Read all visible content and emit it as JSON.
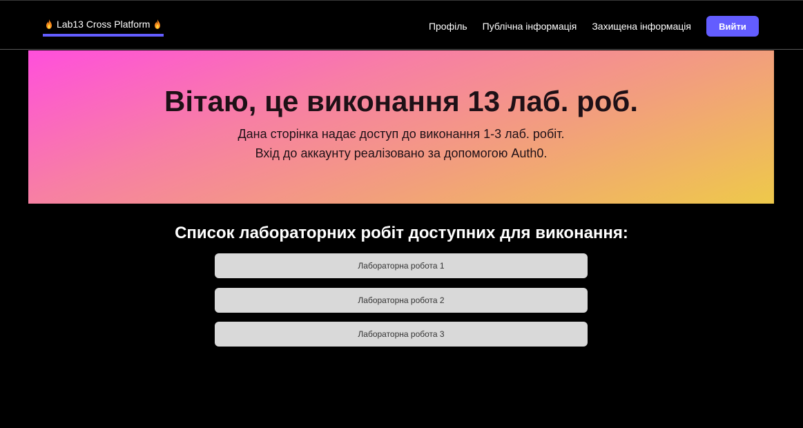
{
  "navbar": {
    "brand_label": "Lab13 Cross Platform",
    "brand_icon": "fire-icon",
    "links": [
      {
        "label": "Профіль"
      },
      {
        "label": "Публічна інформація"
      },
      {
        "label": "Захищена інформація"
      }
    ],
    "logout_label": "Вийти",
    "accent_color": "#635dff"
  },
  "hero": {
    "title": "Вітаю, це виконання 13 лаб. роб.",
    "line1": "Дана сторінка надає доступ до виконання 1-3 лаб. робіт.",
    "line2": "Вхід до аккаунту реалізовано за допомогою Auth0.",
    "gradient_colors": [
      "#ff4fdc",
      "#f77fa4",
      "#f2a07b",
      "#eec94a"
    ]
  },
  "labs": {
    "title": "Список лабораторних робіт доступних для виконання:",
    "items": [
      {
        "label": "Лабораторна робота 1"
      },
      {
        "label": "Лабораторна робота 2"
      },
      {
        "label": "Лабораторна робота 3"
      }
    ]
  }
}
